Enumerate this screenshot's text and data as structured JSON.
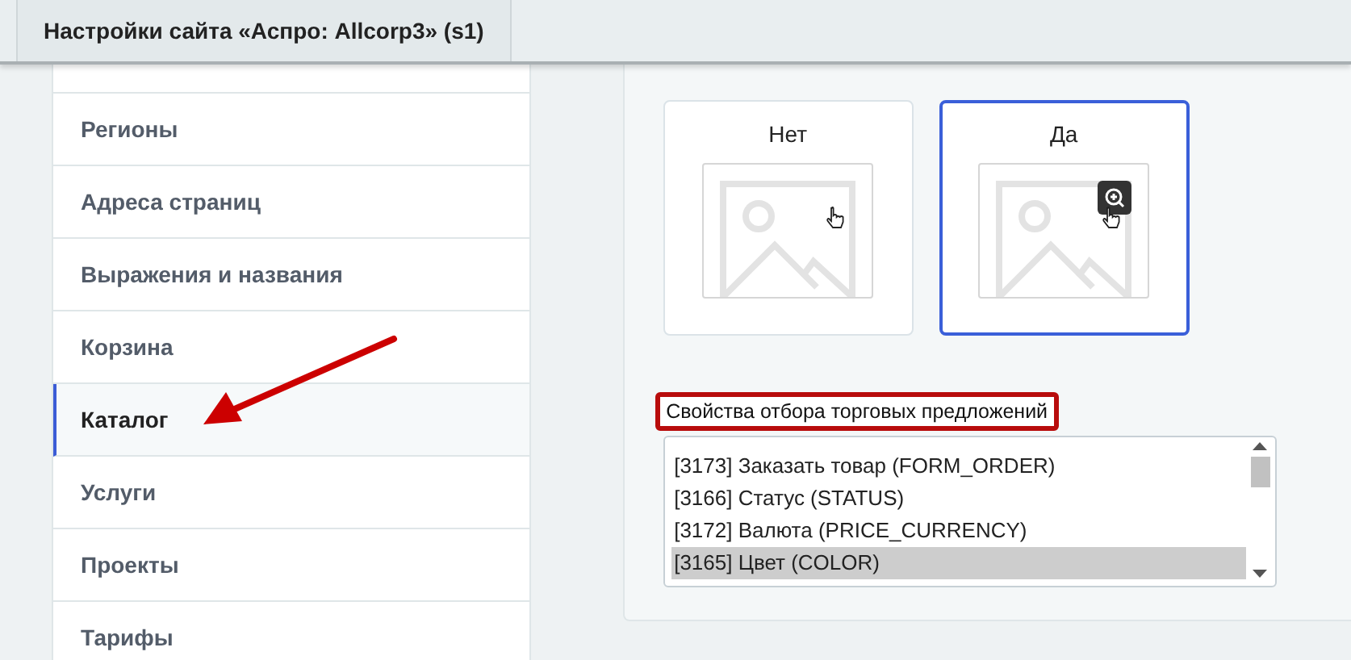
{
  "tabs": [
    {
      "label": "Настройки сайта «Аспро: Allcorp3» (s1)",
      "selected": true
    }
  ],
  "sidebar": {
    "items": [
      {
        "label": "Регионы",
        "selected": false
      },
      {
        "label": "Адреса страниц",
        "selected": false
      },
      {
        "label": "Выражения и названия",
        "selected": false
      },
      {
        "label": "Корзина",
        "selected": false
      },
      {
        "label": "Каталог",
        "selected": true
      },
      {
        "label": "Услуги",
        "selected": false
      },
      {
        "label": "Проекты",
        "selected": false
      },
      {
        "label": "Тарифы",
        "selected": false
      }
    ]
  },
  "options": [
    {
      "label": "Нет",
      "selected": false
    },
    {
      "label": "Да",
      "selected": true
    }
  ],
  "offers_filter": {
    "label": "Свойства отбора торговых предложений",
    "items": [
      {
        "label": "[3173] Заказать товар (FORM_ORDER)",
        "selected": false
      },
      {
        "label": "[3166] Статус (STATUS)",
        "selected": false
      },
      {
        "label": "[3172] Валюта (PRICE_CURRENCY)",
        "selected": false
      },
      {
        "label": "[3165] Цвет (COLOR)",
        "selected": true
      }
    ]
  }
}
